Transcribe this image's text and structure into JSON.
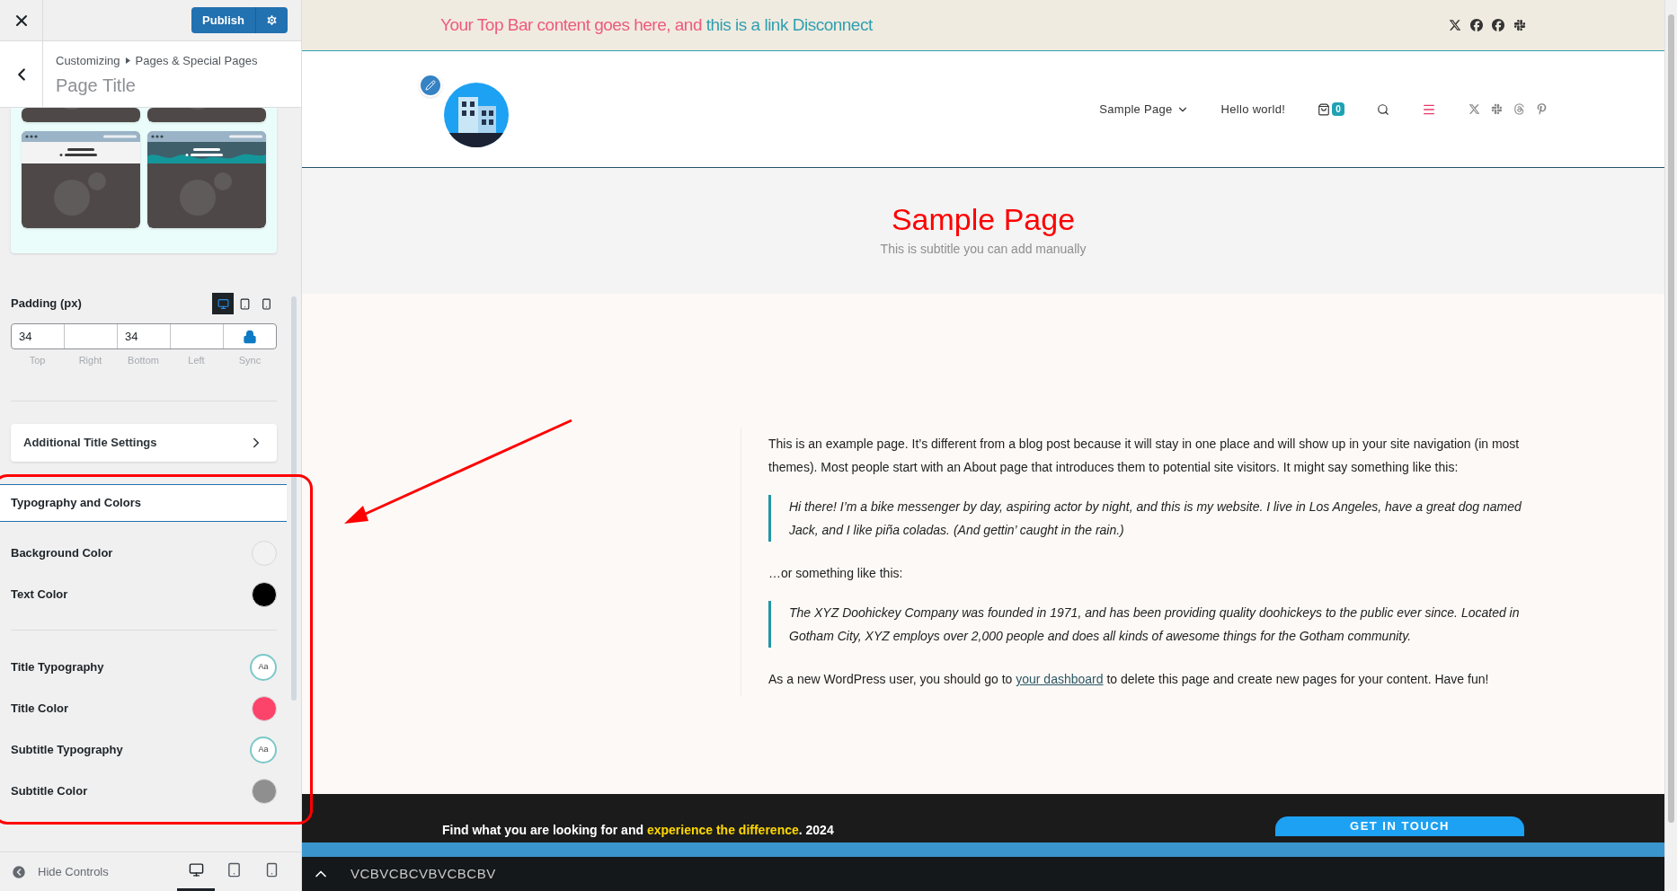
{
  "customizer": {
    "publish_button": "Publish",
    "breadcrumb": [
      "Customizing",
      "Pages & Special Pages"
    ],
    "section_title": "Page Title",
    "padding": {
      "label": "Padding (px)",
      "devices": [
        {
          "kind": "desktop",
          "selected": true
        },
        {
          "kind": "tablet",
          "selected": false
        },
        {
          "kind": "mobile",
          "selected": false
        }
      ],
      "fields": [
        {
          "value": "34",
          "label": "Top"
        },
        {
          "label": "Right"
        },
        {
          "value": "34",
          "label": "Bottom"
        },
        {
          "label": "Left"
        }
      ],
      "sync_label": "Sync"
    },
    "additional_settings": "Additional Title Settings",
    "typography_section": {
      "title": "Typography and Colors",
      "groups": [
        [
          {
            "label": "Background Color",
            "kind": "color",
            "color": "#f2f2f2"
          },
          {
            "label": "Text Color",
            "kind": "color",
            "color": "#000000"
          }
        ],
        [
          {
            "label": "Title Typography",
            "kind": "typography",
            "badge": "Aa"
          },
          {
            "label": "Title Color",
            "kind": "color",
            "color": "#fc4369"
          },
          {
            "label": "Subtitle Typography",
            "kind": "typography",
            "badge": "Aa"
          },
          {
            "label": "Subtitle Color",
            "kind": "color",
            "color": "#8f8f8f"
          }
        ]
      ]
    },
    "footer": {
      "hide_controls": "Hide Controls",
      "devices": [
        {
          "kind": "desktop",
          "selected": true
        },
        {
          "kind": "tablet",
          "selected": false
        },
        {
          "kind": "mobile",
          "selected": false
        }
      ]
    }
  },
  "preview": {
    "top_bar": {
      "text": "Your Top Bar content goes here, and ",
      "link": "this is a link Disconnect"
    },
    "nav": {
      "items": [
        {
          "label": "Sample Page",
          "dropdown": true
        },
        {
          "label": "Hello world!",
          "dropdown": false
        }
      ],
      "cart_count": "0"
    },
    "page_title": "Sample Page",
    "subtitle": "This is subtitle you can add manually",
    "content": [
      {
        "kind": "paragraph",
        "text": "This is an example page. It’s different from a blog post because it will stay in one place and will show up in your site navigation (in most themes). Most people start with an About page that introduces them to potential site visitors. It might say something like this:"
      },
      {
        "kind": "quote",
        "text": "Hi there! I’m a bike messenger by day, aspiring actor by night, and this is my website. I live in Los Angeles, have a great dog named Jack, and I like piña coladas. (And gettin’ caught in the rain.)"
      },
      {
        "kind": "paragraph",
        "text": "…or something like this:"
      },
      {
        "kind": "quote",
        "text": "The XYZ Doohickey Company was founded in 1971, and has been providing quality doohickeys to the public ever since. Located in Gotham City, XYZ employs over 2,000 people and does all kinds of awesome things for the Gotham community."
      },
      {
        "kind": "paragraph",
        "text": "As a new WordPress user, you should go to ",
        "link": "your dashboard",
        "after": " to delete this page and create new pages for your content. Have fun!"
      }
    ],
    "footer": {
      "text": "Find what you are looking for and ",
      "highlight": "experience the difference",
      "after": ". 2024",
      "button": "GET IN TOUCH"
    },
    "bottom_bar": {
      "text": "VCBVCBCVBVCBCBV"
    }
  }
}
